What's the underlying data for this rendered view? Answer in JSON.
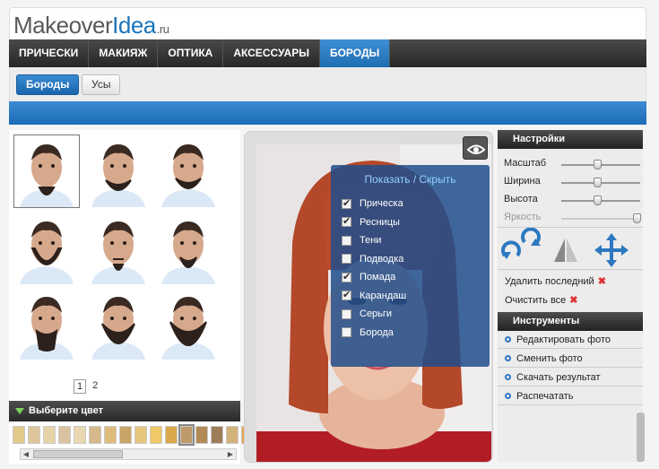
{
  "logo": {
    "main": "Makeover",
    "accent": "Idea",
    "suffix": ".ru"
  },
  "nav": [
    {
      "label": "ПРИЧЕСКИ",
      "active": false
    },
    {
      "label": "МАКИЯЖ",
      "active": false
    },
    {
      "label": "ОПТИКА",
      "active": false
    },
    {
      "label": "АКСЕССУАРЫ",
      "active": false
    },
    {
      "label": "БОРОДЫ",
      "active": true
    }
  ],
  "subtabs": [
    {
      "label": "Бороды",
      "active": true
    },
    {
      "label": "Усы",
      "active": false
    }
  ],
  "gallery": {
    "beards": [
      "goatee",
      "short",
      "stubble",
      "chin-strap",
      "van-dyke",
      "circle",
      "horseshoe",
      "full",
      "long-full"
    ],
    "selected_index": 0,
    "pages": [
      "1",
      "2"
    ],
    "current_page": "1"
  },
  "color_picker": {
    "title": "Выберите цвет",
    "swatches": [
      "#e2c98a",
      "#dec69a",
      "#e6d3a8",
      "#d9c2a0",
      "#e9d7b1",
      "#d5b98a",
      "#ddbc7a",
      "#c9a467",
      "#e7c67e",
      "#f0c867",
      "#d9a94c",
      "#bf9a6a",
      "#b38a55",
      "#9e7d5a",
      "#d4b37a",
      "#e4a74f",
      "#8f6540"
    ],
    "selected_index": 11
  },
  "visibility": {
    "title": "Показать / Скрыть",
    "items": [
      {
        "label": "Прическа",
        "checked": true
      },
      {
        "label": "Ресницы",
        "checked": true
      },
      {
        "label": "Тени",
        "checked": false
      },
      {
        "label": "Подводка",
        "checked": false
      },
      {
        "label": "Помада",
        "checked": true
      },
      {
        "label": "Карандаш",
        "checked": true
      },
      {
        "label": "Серьги",
        "checked": false
      },
      {
        "label": "Борода",
        "checked": false
      }
    ]
  },
  "settings": {
    "title": "Настройки",
    "sliders": [
      {
        "label": "Масштаб",
        "value": 0.45,
        "disabled": false
      },
      {
        "label": "Ширина",
        "value": 0.45,
        "disabled": false
      },
      {
        "label": "Высота",
        "value": 0.45,
        "disabled": false
      },
      {
        "label": "Яркость",
        "value": 0.95,
        "disabled": true
      }
    ],
    "remove_last": "Удалить последний",
    "clear_all": "Очистить все"
  },
  "tools": {
    "title": "Инструменты",
    "items": [
      "Редактировать фото",
      "Сменить фото",
      "Скачать результат",
      "Распечатать"
    ]
  },
  "colors": {
    "accent": "#1f6db3",
    "dark": "#2a2a2a",
    "panel": "#ececec"
  }
}
